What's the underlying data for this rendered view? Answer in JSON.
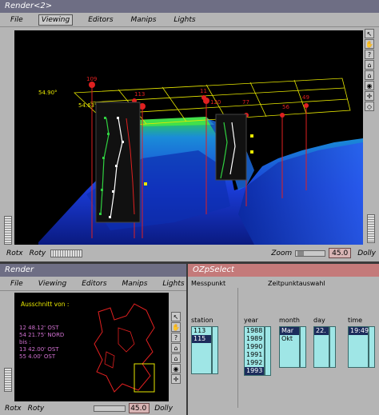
{
  "top": {
    "title": "Render<2>",
    "menu": [
      "File",
      "Viewing",
      "Editors",
      "Manips",
      "Lights"
    ],
    "active_menu": "Viewing",
    "bottom": {
      "rotx": "Rotx",
      "roty": "Roty",
      "zoom": "Zoom",
      "zoom_value": "45.0",
      "dolly": "Dolly"
    },
    "scene_labels": {
      "lat_top": "54.90°",
      "lat_mid": "54.63°",
      "pins": [
        "109",
        "113",
        "11",
        "120",
        "77",
        "56",
        "49"
      ]
    }
  },
  "render": {
    "title": "Render",
    "menu": [
      "File",
      "Viewing",
      "Editors",
      "Manips",
      "Lights"
    ],
    "info": {
      "heading": "Ausschnitt von :",
      "line1": "12  48.12' OST",
      "line2": "54  21.75' NORD",
      "bis": "bis :",
      "line3": "13  42.00' OST",
      "line4": "55  4.00' OST"
    },
    "bottom": {
      "rotx": "Rotx",
      "roty": "Roty",
      "zoom_value": "45.0",
      "dolly": "Dolly"
    }
  },
  "select": {
    "title": "OZpSelect",
    "messpunkt": "Messpunkt",
    "zeitpunkt": "Zeitpunktauswahl",
    "station": {
      "label": "station",
      "items": [
        "113",
        "115"
      ],
      "selected": 1
    },
    "year": {
      "label": "year",
      "items": [
        "1988",
        "1989",
        "1990",
        "1991",
        "1992",
        "1993"
      ],
      "selected": 5
    },
    "month": {
      "label": "month",
      "items": [
        "Mar",
        "Okt"
      ],
      "selected": 0
    },
    "day": {
      "label": "day",
      "items": [
        "22."
      ],
      "selected": 0
    },
    "time": {
      "label": "time",
      "items": [
        "19:49"
      ],
      "selected": 0
    }
  },
  "colors": {
    "accent": "#d8b4b4",
    "list": "#9fe6e6",
    "titlebar": "#6e6e84",
    "panel": "#b5b5b5"
  },
  "icons": [
    "arrow-icon",
    "hand-icon",
    "question-icon",
    "home-icon",
    "home-set-icon",
    "eye-icon",
    "crosshair-icon",
    "perspective-icon"
  ]
}
